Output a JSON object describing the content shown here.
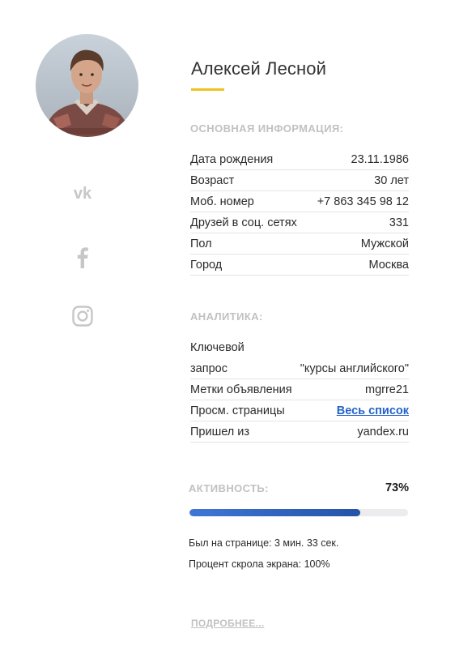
{
  "profile": {
    "name": "Алексей Лесной",
    "avatar_icon": "user-photo"
  },
  "social": [
    {
      "icon": "vk-icon"
    },
    {
      "icon": "facebook-icon"
    },
    {
      "icon": "instagram-icon"
    }
  ],
  "basic": {
    "title": "ОСНОВНАЯ ИНФОРМАЦИЯ:",
    "rows": [
      {
        "label": "Дата рождения",
        "value": "23.11.1986"
      },
      {
        "label": "Возраст",
        "value": "30 лет"
      },
      {
        "label": "Моб. номер",
        "value": "+7 863 345 98 12"
      },
      {
        "label": "Друзей в соц. сетях",
        "value": "331"
      },
      {
        "label": "Пол",
        "value": "Мужской"
      },
      {
        "label": "Город",
        "value": "Москва"
      }
    ]
  },
  "analytics": {
    "title": "АНАЛИТИКА:",
    "keyword_label_line1": "Ключевой",
    "keyword_label_line2": "запрос",
    "keyword_value": "\"курсы английского\"",
    "rows": [
      {
        "label": "Метки объявления",
        "value": "mgrre21"
      },
      {
        "label": "Просм. страницы",
        "value": "Весь список"
      },
      {
        "label": "Пришел из",
        "value": "yandex.ru"
      }
    ]
  },
  "activity": {
    "title": "АКТИВНОСТЬ:",
    "value_text": "73%",
    "progress_fraction": 0.78,
    "time_on_page": "Был на странице: 3 мин. 33 сек.",
    "scroll_percent": "Процент скрола экрана: 100%"
  },
  "more_link": "ПОДРОБНЕЕ...",
  "colors": {
    "accent": "#f1c21b",
    "link": "#2563c9",
    "progress": "#2f62bf",
    "muted": "#c1c1c1"
  }
}
